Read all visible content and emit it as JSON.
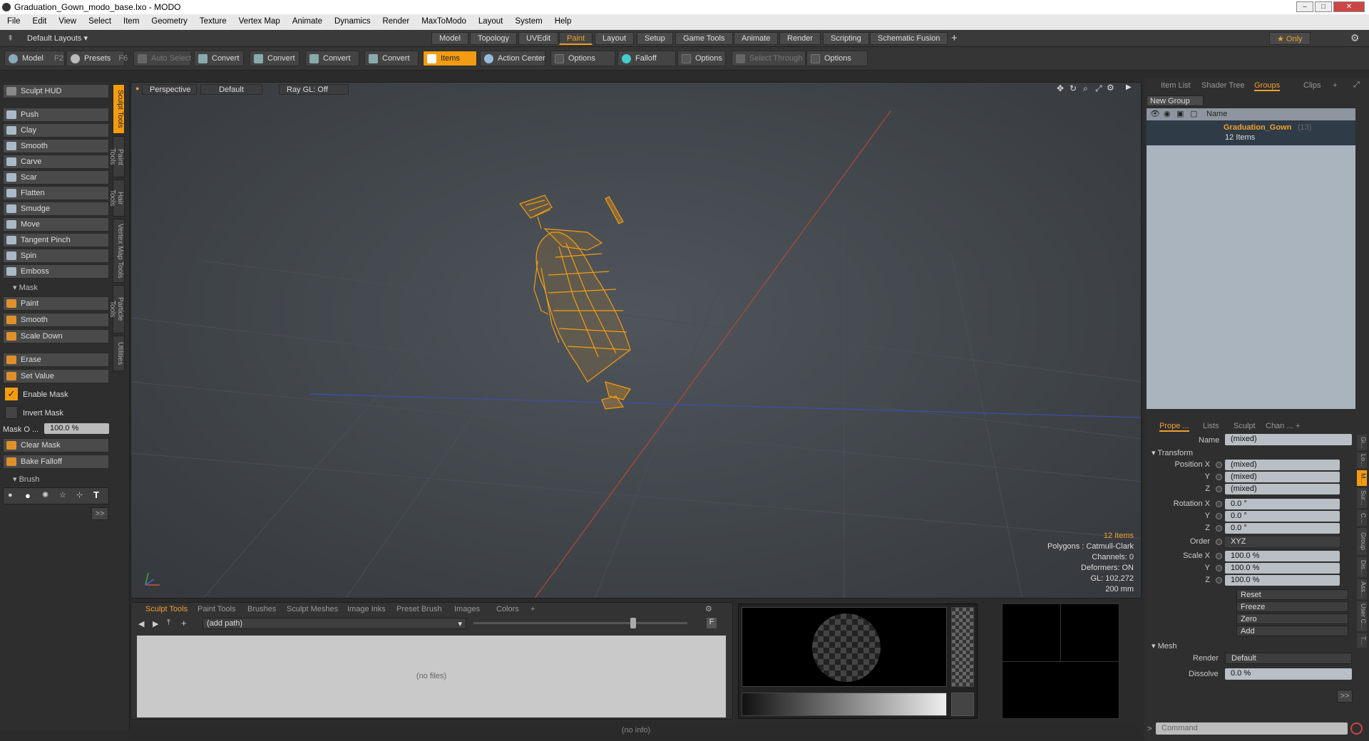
{
  "window": {
    "title": "Graduation_Gown_modo_base.lxo - MODO"
  },
  "menu": [
    "File",
    "Edit",
    "View",
    "Select",
    "Item",
    "Geometry",
    "Texture",
    "Vertex Map",
    "Animate",
    "Dynamics",
    "Render",
    "MaxToModo",
    "Layout",
    "System",
    "Help"
  ],
  "layout_tabs": {
    "default_layouts": "Default Layouts ▾",
    "tabs": [
      "Model",
      "Topology",
      "UVEdit",
      "Paint",
      "Layout",
      "Setup",
      "Game Tools",
      "Animate",
      "Render",
      "Scripting",
      "Schematic Fusion"
    ],
    "active": "Paint",
    "plus": "+",
    "only": "★  Only"
  },
  "toolbar": {
    "model": "Model",
    "model_key": "F2",
    "presets": "Presets",
    "presets_key": "F6",
    "auto_select": "Auto Select",
    "convert1": "Convert",
    "convert2": "Convert",
    "convert3": "Convert",
    "convert4": "Convert",
    "items": "Items",
    "action_center": "Action Center",
    "options1": "Options",
    "falloff": "Falloff",
    "options2": "Options",
    "select_through": "Select Through",
    "options3": "Options"
  },
  "left": {
    "sculpt_hud": "Sculpt HUD",
    "tools": [
      "Push",
      "Clay",
      "Smooth",
      "Carve",
      "Scar",
      "Flatten",
      "Smudge",
      "Move",
      "Tangent Pinch",
      "Spin",
      "Emboss"
    ],
    "mask_header": "Mask",
    "mask_tools": [
      "Paint",
      "Smooth",
      "Scale Down"
    ],
    "erase": "Erase",
    "set_value": "Set Value",
    "enable_mask": "Enable Mask",
    "invert_mask": "Invert Mask",
    "mask_opacity_label": "Mask O ...",
    "mask_opacity_value": "100.0 %",
    "clear_mask": "Clear Mask",
    "bake_falloff": "Bake Falloff",
    "brush_header": "Brush",
    "more": ">>",
    "vtabs": [
      "Sculpt Tools",
      "Paint Tools",
      "Hair Tools",
      "Vertex Map Tools",
      "Particle Tools",
      "Utilities"
    ]
  },
  "viewport": {
    "view": "Perspective",
    "shading": "Default",
    "raygl": "Ray GL: Off",
    "info": {
      "items": "12 Items",
      "polygons": "Polygons : Catmull-Clark",
      "channels": "Channels: 0",
      "deformers": "Deformers: ON",
      "gl": "GL: 102,272",
      "scale": "200 mm"
    }
  },
  "bottom": {
    "tabs": [
      "Sculpt Tools",
      "Paint Tools",
      "Brushes",
      "Sculpt Meshes",
      "Image Inks",
      "Preset Brush",
      "Images",
      "Colors",
      "+"
    ],
    "active": "Sculpt Tools",
    "path": "(add path)",
    "no_files": "(no files)",
    "f": "F"
  },
  "status": "(no info)",
  "right": {
    "tabs": [
      "Item List",
      "Shader Tree",
      "Groups",
      "Clips",
      "+"
    ],
    "active": "Groups",
    "new_group": "New Group",
    "name_col": "Name",
    "group_name": "Graduation_Gown",
    "group_count": "(13)",
    "group_items": "12 Items",
    "ptabs": [
      "Prope ...",
      "Lists",
      "Sculpt",
      "Chan ...",
      "+"
    ],
    "pactive": "Prope ...",
    "name_label": "Name",
    "name_value": "(mixed)",
    "transform": "Transform",
    "rows": [
      {
        "label": "Position X",
        "value": "(mixed)"
      },
      {
        "label": "Y",
        "value": "(mixed)"
      },
      {
        "label": "Z",
        "value": "(mixed)"
      },
      {
        "label": "Rotation X",
        "value": "0.0 °"
      },
      {
        "label": "Y",
        "value": "0.0 °"
      },
      {
        "label": "Z",
        "value": "0.0 °"
      },
      {
        "label": "Order",
        "value": "XYZ"
      },
      {
        "label": "Scale X",
        "value": "100.0 %"
      },
      {
        "label": "Y",
        "value": "100.0 %"
      },
      {
        "label": "Z",
        "value": "100.0 %"
      }
    ],
    "actions": [
      "Reset",
      "Freeze",
      "Zero",
      "Add"
    ],
    "mesh": "Mesh",
    "render_label": "Render",
    "render_value": "Default",
    "dissolve_label": "Dissolve",
    "dissolve_value": "0.0 %",
    "more": ">>",
    "command": "Command",
    "side": [
      "Gi...",
      "Lo...",
      "M...",
      "Sur...",
      "C...",
      "Group",
      "Dis...",
      "Ass...",
      "User C...",
      "T..."
    ]
  }
}
